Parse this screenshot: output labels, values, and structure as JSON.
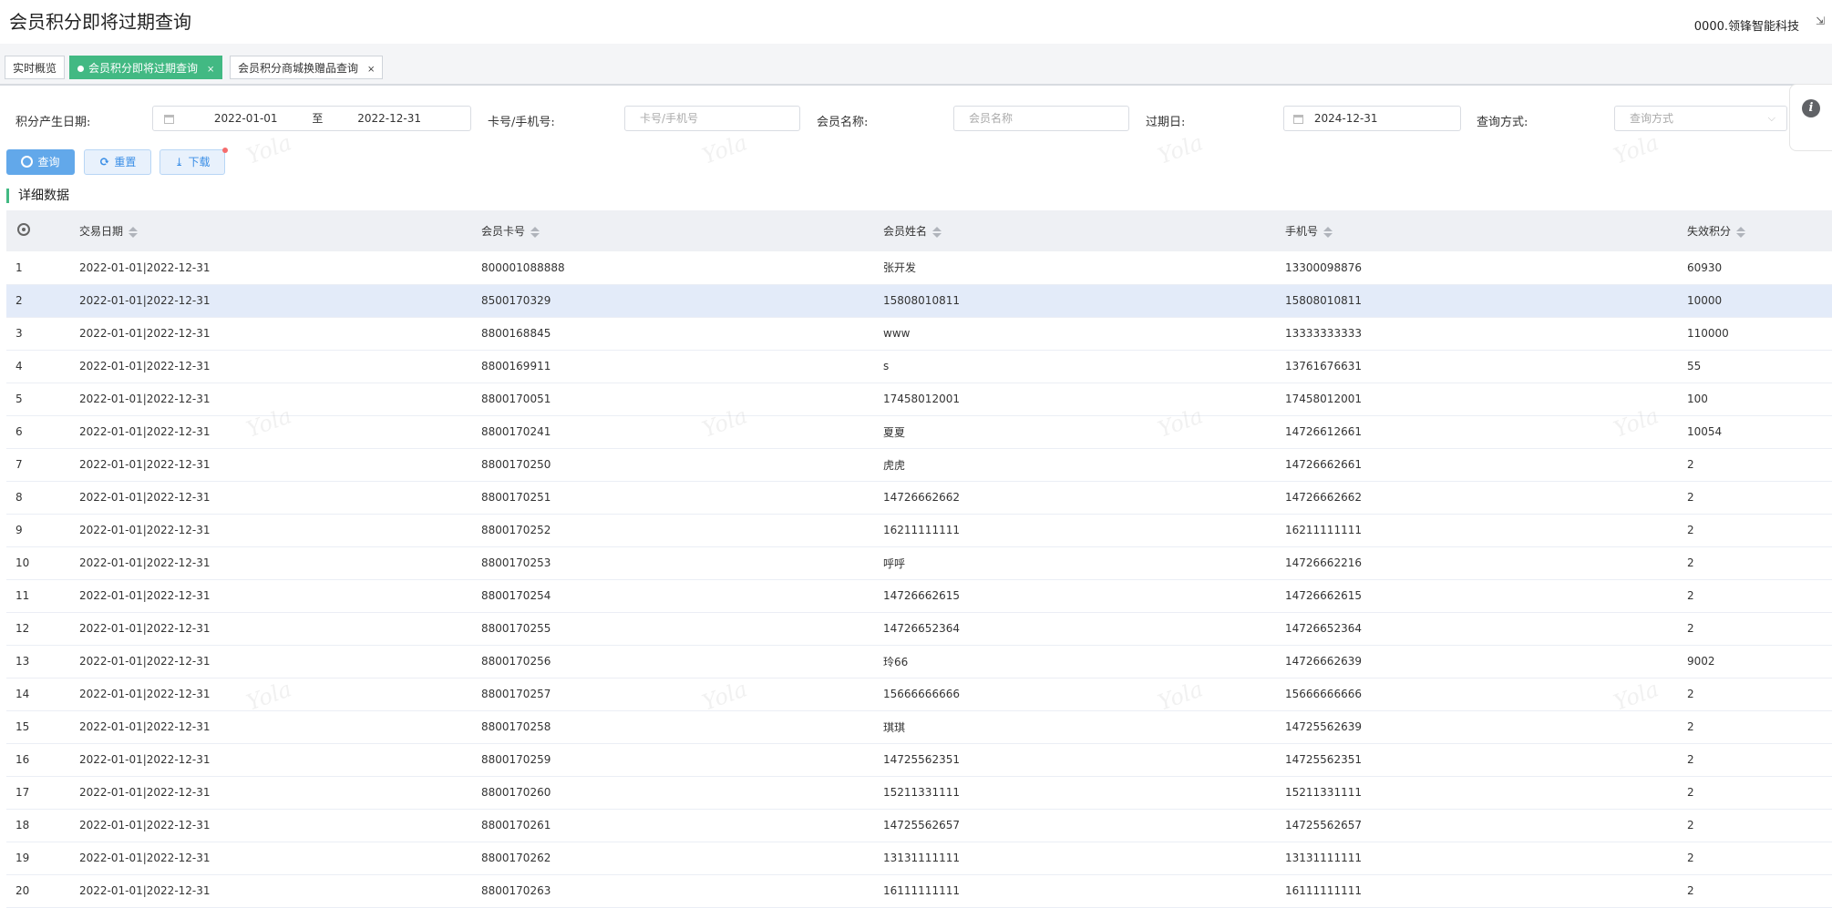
{
  "header": {
    "title": "会员积分即将过期查询",
    "company": "0000.领锋智能科技",
    "download_glyph": "⇲"
  },
  "tabs": [
    {
      "label": "实时概览"
    },
    {
      "label": "会员积分即将过期查询",
      "close": "×"
    },
    {
      "label": "会员积分商城换赠品查询",
      "close": "×"
    }
  ],
  "filters": {
    "date_label": "积分产生日期:",
    "date_start": "2022-01-01",
    "date_sep": "至",
    "date_end": "2022-12-31",
    "card_label": "卡号/手机号:",
    "card_placeholder": "卡号/手机号",
    "name_label": "会员名称:",
    "name_placeholder": "会员名称",
    "expire_label": "过期日:",
    "expire_value": "2024-12-31",
    "method_label": "查询方式:",
    "method_placeholder": "查询方式"
  },
  "buttons": {
    "query": "查询",
    "reset": "重置",
    "download": "下载"
  },
  "section_title": "详细数据",
  "watermark": "Yola",
  "table": {
    "columns": [
      "交易日期",
      "会员卡号",
      "会员姓名",
      "手机号",
      "失效积分"
    ],
    "rows": [
      [
        "1",
        "2022-01-01|2022-12-31",
        "800001088888",
        "张开发",
        "13300098876",
        "60930"
      ],
      [
        "2",
        "2022-01-01|2022-12-31",
        "8500170329",
        "15808010811",
        "15808010811",
        "10000"
      ],
      [
        "3",
        "2022-01-01|2022-12-31",
        "8800168845",
        "www",
        "13333333333",
        "110000"
      ],
      [
        "4",
        "2022-01-01|2022-12-31",
        "8800169911",
        "s",
        "13761676631",
        "55"
      ],
      [
        "5",
        "2022-01-01|2022-12-31",
        "8800170051",
        "17458012001",
        "17458012001",
        "100"
      ],
      [
        "6",
        "2022-01-01|2022-12-31",
        "8800170241",
        "夏夏",
        "14726612661",
        "10054"
      ],
      [
        "7",
        "2022-01-01|2022-12-31",
        "8800170250",
        "虎虎",
        "14726662661",
        "2"
      ],
      [
        "8",
        "2022-01-01|2022-12-31",
        "8800170251",
        "14726662662",
        "14726662662",
        "2"
      ],
      [
        "9",
        "2022-01-01|2022-12-31",
        "8800170252",
        "16211111111",
        "16211111111",
        "2"
      ],
      [
        "10",
        "2022-01-01|2022-12-31",
        "8800170253",
        "呼呼",
        "14726662216",
        "2"
      ],
      [
        "11",
        "2022-01-01|2022-12-31",
        "8800170254",
        "14726662615",
        "14726662615",
        "2"
      ],
      [
        "12",
        "2022-01-01|2022-12-31",
        "8800170255",
        "14726652364",
        "14726652364",
        "2"
      ],
      [
        "13",
        "2022-01-01|2022-12-31",
        "8800170256",
        "玲66",
        "14726662639",
        "9002"
      ],
      [
        "14",
        "2022-01-01|2022-12-31",
        "8800170257",
        "15666666666",
        "15666666666",
        "2"
      ],
      [
        "15",
        "2022-01-01|2022-12-31",
        "8800170258",
        "琪琪",
        "14725562639",
        "2"
      ],
      [
        "16",
        "2022-01-01|2022-12-31",
        "8800170259",
        "14725562351",
        "14725562351",
        "2"
      ],
      [
        "17",
        "2022-01-01|2022-12-31",
        "8800170260",
        "15211331111",
        "15211331111",
        "2"
      ],
      [
        "18",
        "2022-01-01|2022-12-31",
        "8800170261",
        "14725562657",
        "14725562657",
        "2"
      ],
      [
        "19",
        "2022-01-01|2022-12-31",
        "8800170262",
        "13131111111",
        "13131111111",
        "2"
      ],
      [
        "20",
        "2022-01-01|2022-12-31",
        "8800170263",
        "16111111111",
        "16111111111",
        "2"
      ]
    ]
  }
}
